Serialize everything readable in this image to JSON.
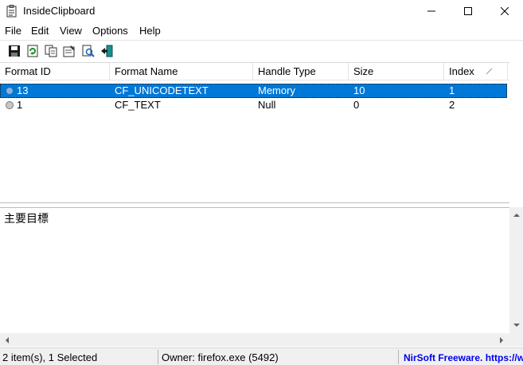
{
  "window": {
    "title": "InsideClipboard"
  },
  "menu": [
    "File",
    "Edit",
    "View",
    "Options",
    "Help"
  ],
  "toolbar": {
    "buttons": [
      "save-icon",
      "refresh-icon",
      "copy-icon",
      "properties-icon",
      "find-icon",
      "exit-icon"
    ]
  },
  "list": {
    "columns": [
      "Format ID",
      "Format Name",
      "Handle Type",
      "Size",
      "Index"
    ],
    "rows": [
      {
        "format_id": "13",
        "format_name": "CF_UNICODETEXT",
        "handle_type": "Memory",
        "size": "10",
        "index": "1",
        "selected": true
      },
      {
        "format_id": "1",
        "format_name": "CF_TEXT",
        "handle_type": "Null",
        "size": "0",
        "index": "2",
        "selected": false
      }
    ]
  },
  "content": {
    "text": "主要目標"
  },
  "status": {
    "items": "2 item(s), 1 Selected",
    "owner": "Owner: firefox.exe (5492)",
    "link": "NirSoft Freeware. https://www.nirsoft.net"
  },
  "colors": {
    "selection": "#0078d7",
    "link": "#0000ee",
    "statusbar": "#f0f0f0"
  }
}
